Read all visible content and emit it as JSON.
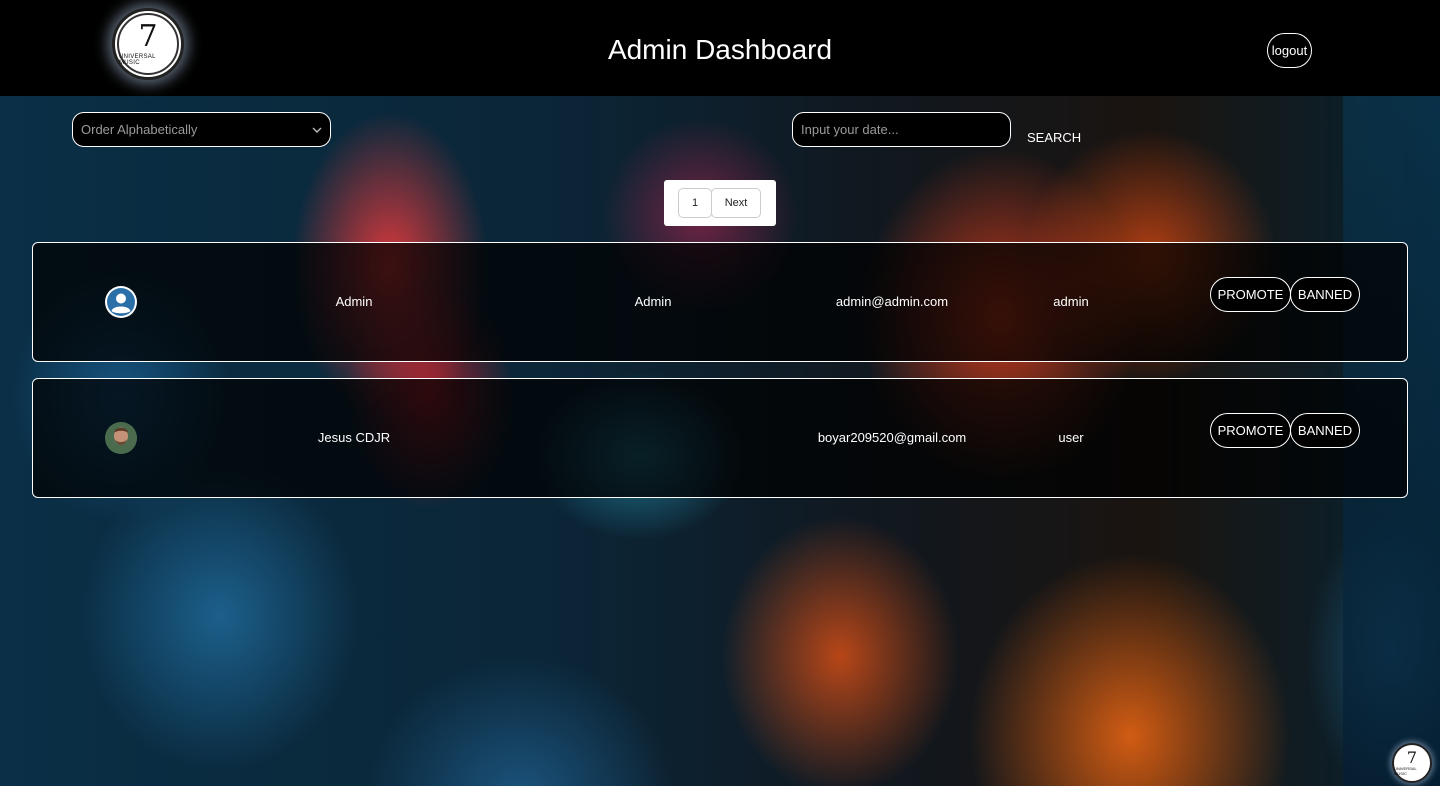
{
  "header": {
    "logo_text": "UNIVERSAL MUSIC",
    "logo_mark": "7",
    "title": "Admin Dashboard",
    "logout_label": "logout"
  },
  "filters": {
    "sort_placeholder": "Order Alphabetically",
    "date_placeholder": "Input your date...",
    "search_label": "SEARCH"
  },
  "pagination": {
    "current_page": "1",
    "next_label": "Next"
  },
  "users": [
    {
      "avatar": "default-user-icon",
      "name": "Admin",
      "username": "Admin",
      "email": "admin@admin.com",
      "role": "admin",
      "promote_label": "PROMOTE",
      "banned_label": "BANNED"
    },
    {
      "avatar": "user-photo",
      "name": "Jesus CDJR",
      "username": "",
      "email": "boyar209520@gmail.com",
      "role": "user",
      "promote_label": "PROMOTE",
      "banned_label": "BANNED"
    }
  ],
  "colors": {
    "header_bg": "#000000",
    "accent": "#ffffff",
    "avatar_blue": "#2a6fa8"
  }
}
